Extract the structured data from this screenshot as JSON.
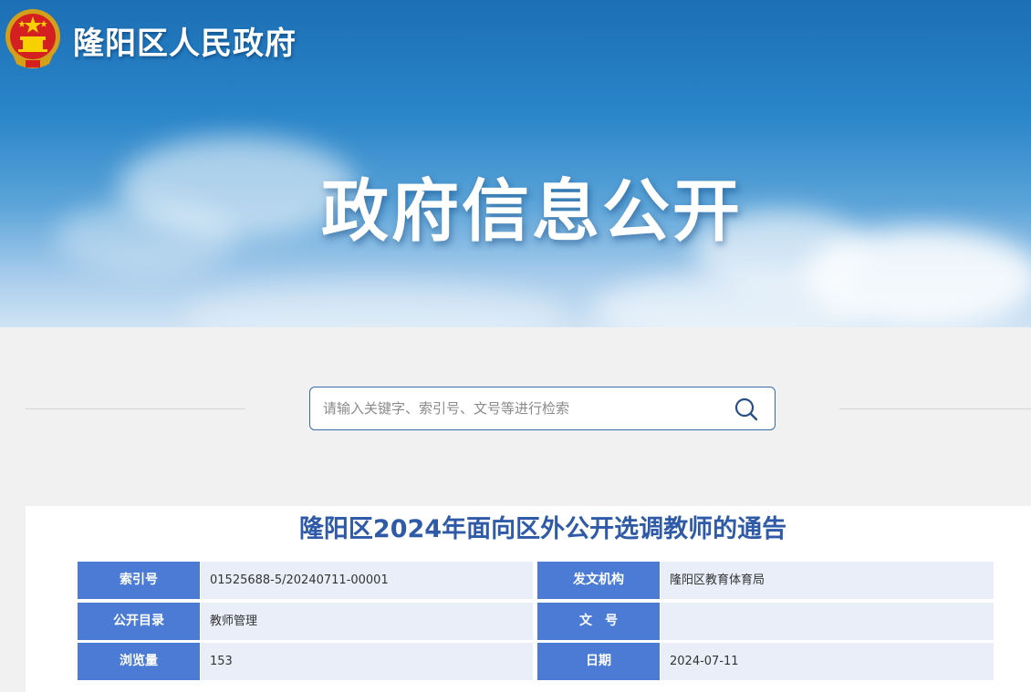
{
  "header": {
    "site_title": "隆阳区人民政府",
    "hero_title": "政府信息公开"
  },
  "search": {
    "placeholder": "请输入关键字、索引号、文号等进行检索",
    "value": ""
  },
  "article": {
    "title": "隆阳区2024年面向区外公开选调教师的通告"
  },
  "meta": [
    {
      "left_label": "索引号",
      "left_value": "01525688-5/20240711-00001",
      "right_label": "发文机构",
      "right_value": "隆阳区教育体育局"
    },
    {
      "left_label": "公开目录",
      "left_value": "教师管理",
      "right_label": "文　号",
      "right_value": ""
    },
    {
      "left_label": "浏览量",
      "left_value": "153",
      "right_label": "日期",
      "right_value": "2024-07-11"
    }
  ],
  "colors": {
    "accent": "#2e5aa8",
    "label_bg": "#4b7bd4",
    "value_bg": "#e9eef8",
    "banner": "#2a85c9"
  },
  "icons": {
    "emblem": "national-emblem-icon",
    "search": "search-icon"
  }
}
